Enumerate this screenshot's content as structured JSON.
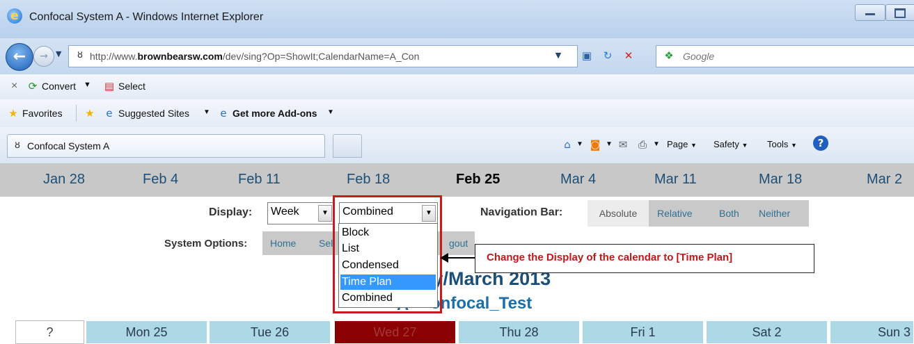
{
  "window": {
    "title": "Confocal System A - Windows Internet Explorer"
  },
  "address": {
    "prefix": "http://www.",
    "domain": "brownbearsw.com",
    "rest": "/dev/sing?Op=ShowIt;CalendarName=A_Con"
  },
  "search": {
    "placeholder": "Google"
  },
  "addons": {
    "close": "×",
    "convert": "Convert",
    "select": "Select"
  },
  "favorites": {
    "favorites": "Favorites",
    "suggested": "Suggested Sites",
    "addons": "Get more Add-ons"
  },
  "tab": {
    "title": "Confocal System A"
  },
  "commands": {
    "page": "Page",
    "safety": "Safety",
    "tools": "Tools"
  },
  "nav_dates": [
    "Jan 28",
    "Feb 4",
    "Feb 11",
    "Feb 18",
    "Feb 25",
    "Mar 4",
    "Mar 11",
    "Mar 18",
    "Mar 2"
  ],
  "display": {
    "label": "Display:",
    "period_value": "Week",
    "view_value": "Combined",
    "options": [
      "Block",
      "List",
      "Condensed",
      "Time Plan",
      "Combined"
    ],
    "highlighted": "Time Plan"
  },
  "navbar": {
    "label": "Navigation Bar:",
    "options": [
      "Absolute",
      "Relative",
      "Both",
      "Neither"
    ]
  },
  "system": {
    "label": "System Options:",
    "home": "Home",
    "sel_partial": "Sel",
    "logout_partial": "gout"
  },
  "annotation": {
    "text": "Change the Display of the calendar to [Time Plan]"
  },
  "calendar": {
    "title_visible": "ary/March 2013",
    "subtitle_visible": "onfocal_Test",
    "subtitle_prefix": "A_"
  },
  "days": [
    "?",
    "Mon 25",
    "Tue 26",
    "Wed 27",
    "Thu 28",
    "Fri 1",
    "Sat 2",
    "Sun 3"
  ],
  "colors": {
    "accent_red": "#c21c1c",
    "highlight": "#3399ff",
    "day_header": "#add8e6",
    "today": "#8b0000"
  }
}
